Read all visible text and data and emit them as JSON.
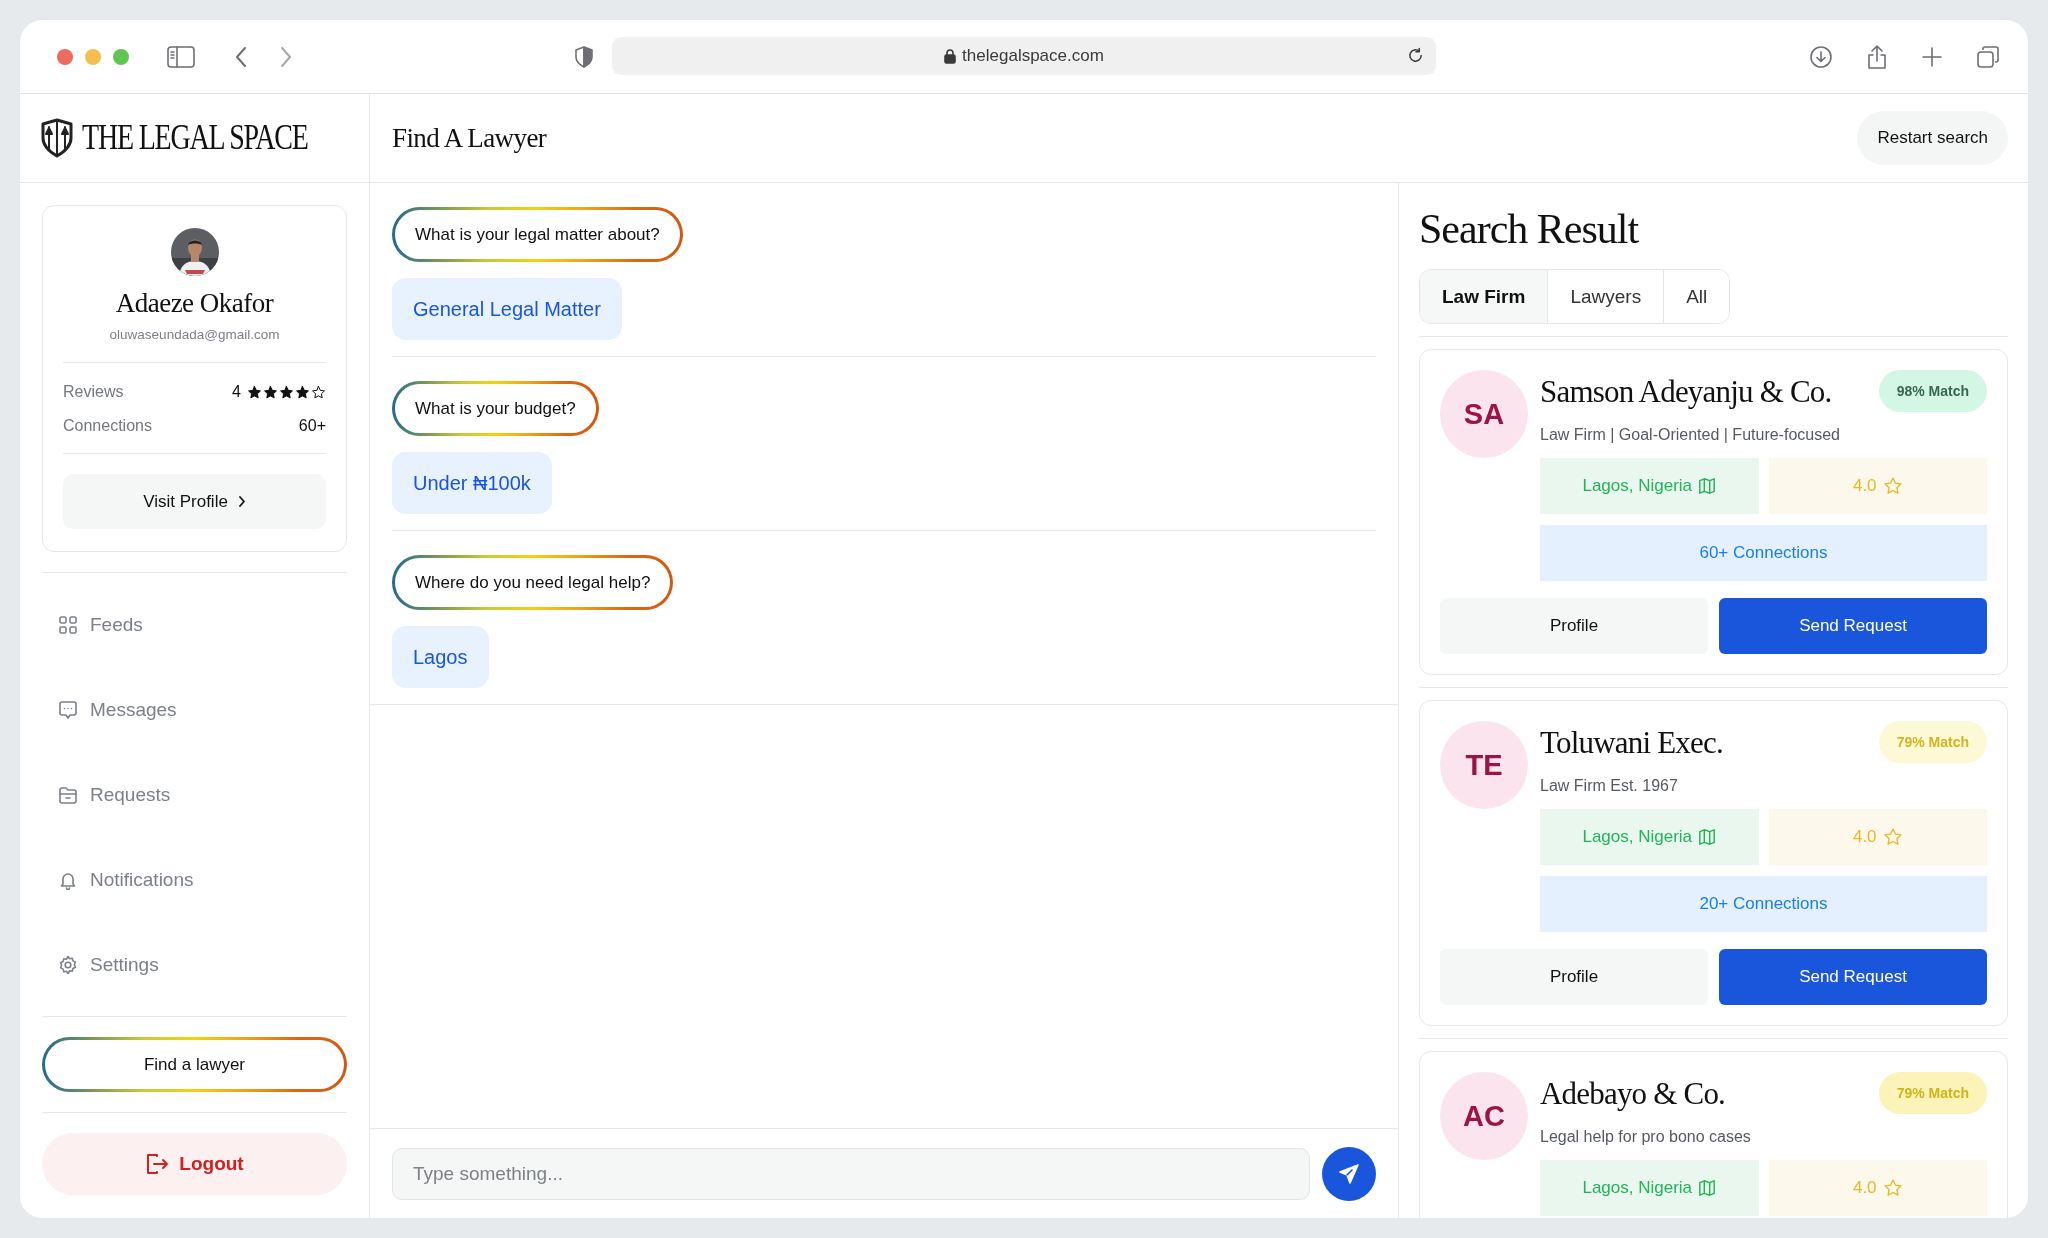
{
  "browser": {
    "url": "thelegalspace.com"
  },
  "sidebar": {
    "logo": "THE LEGAL SPACE",
    "profile": {
      "name": "Adaeze Okafor",
      "email": "oluwaseundada@gmail.com",
      "stats": [
        {
          "label": "Reviews",
          "value": "4",
          "stars": 4
        },
        {
          "label": "Connections",
          "value": "60+"
        }
      ],
      "visit_button": "Visit Profile"
    },
    "nav": [
      {
        "label": "Feeds"
      },
      {
        "label": "Messages"
      },
      {
        "label": "Requests"
      },
      {
        "label": "Notifications"
      },
      {
        "label": "Settings"
      }
    ],
    "find_button": "Find a lawyer",
    "logout_button": "Logout"
  },
  "header": {
    "title": "Find A Lawyer",
    "restart_button": "Restart search"
  },
  "chat": [
    {
      "question": "What is your legal matter about?",
      "answer": "General Legal Matter"
    },
    {
      "question": "What is your budget?",
      "answer": "Under ₦100k"
    },
    {
      "question": "Where do you need legal help?",
      "answer": "Lagos"
    }
  ],
  "input": {
    "placeholder": "Type something..."
  },
  "results": {
    "title": "Search Result",
    "tabs": [
      {
        "label": "Law Firm",
        "selected": true
      },
      {
        "label": "Lawyers",
        "selected": false
      },
      {
        "label": "All",
        "selected": false
      }
    ],
    "cards": [
      {
        "initials": "SA",
        "name": "Samson Adeyanju & Co.",
        "match": "98% Match",
        "color": "#d4f6e4",
        "description": "Law Firm | Goal-Oriented | Future-focused",
        "location": "Lagos, Nigeria",
        "rating": "4.0",
        "connections": "60+ Connections",
        "profile_button": "Profile",
        "request_button": "Send Request"
      },
      {
        "initials": "TE",
        "name": "Toluwani Exec.",
        "match": "79% Match",
        "color": "#fdf9d6",
        "description": "Law Firm Est. 1967",
        "location": "Lagos, Nigeria",
        "rating": "4.0",
        "connections": "20+ Connections",
        "profile_button": "Profile",
        "request_button": "Send Request"
      },
      {
        "initials": "AC",
        "name": "Adebayo & Co.",
        "match": "79% Match",
        "color": "#fbf3b8",
        "description": "Legal help for pro bono cases",
        "location": "Lagos, Nigeria",
        "rating": "4.0"
      }
    ]
  }
}
